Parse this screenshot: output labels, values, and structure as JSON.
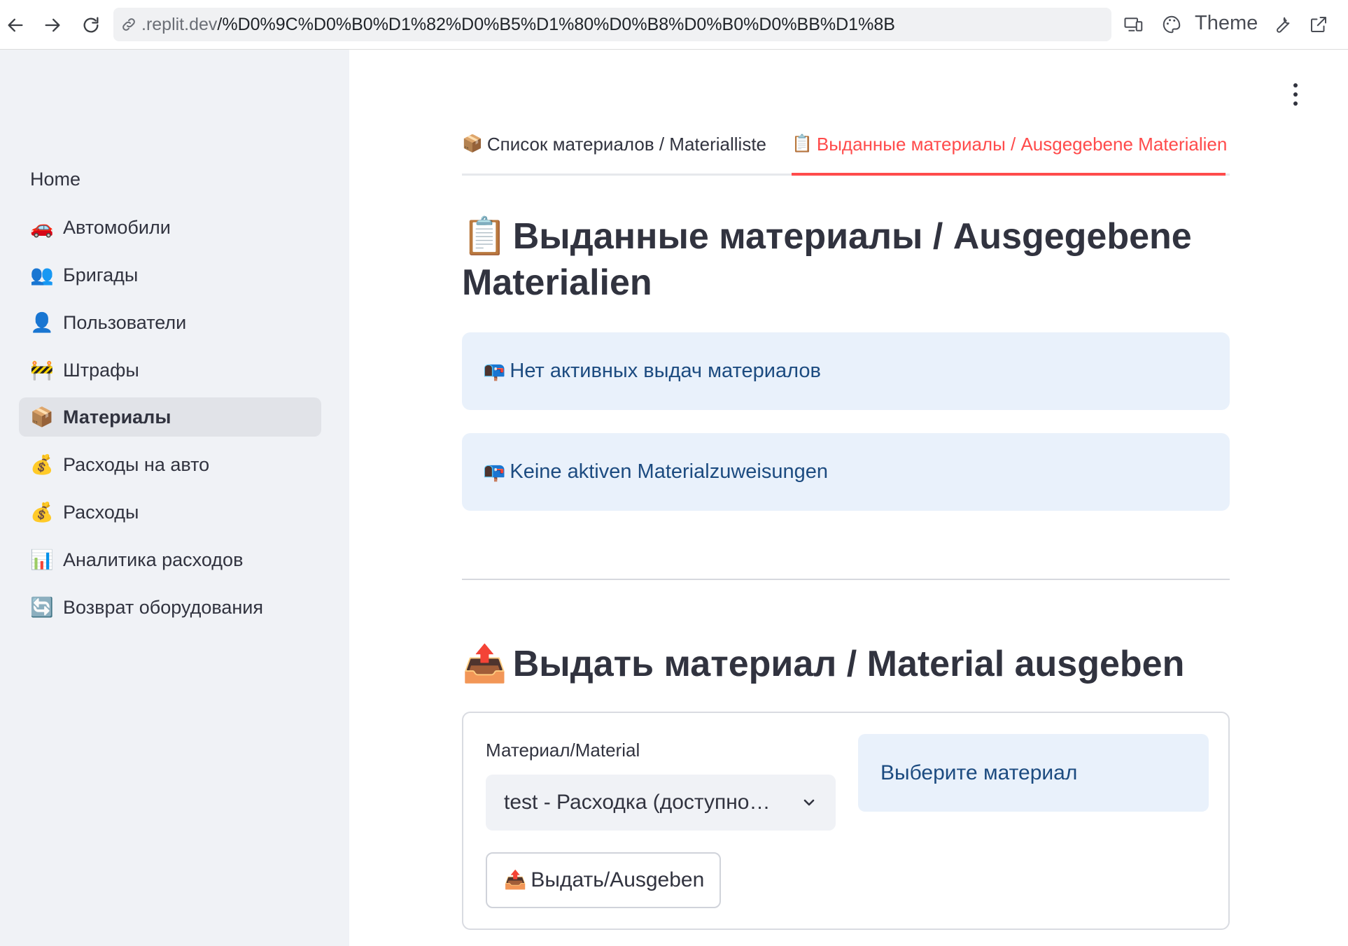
{
  "browser": {
    "url_host": ".replit.dev",
    "url_path": "/%D0%9C%D0%B0%D1%82%D0%B5%D1%80%D0%B8%D0%B0%D0%BB%D1%8B",
    "theme_label": "Theme",
    "icons": [
      "back-arrow-icon",
      "forward-arrow-icon",
      "reload-icon",
      "link-icon",
      "devices-icon",
      "palette-icon",
      "wrench-icon",
      "external-link-icon"
    ]
  },
  "sidebar": {
    "home_label": "Home",
    "items": [
      {
        "emoji": "🚗",
        "label": "Автомобили"
      },
      {
        "emoji": "👥",
        "label": "Бригады"
      },
      {
        "emoji": "👤",
        "label": "Пользователи"
      },
      {
        "emoji": "🚧",
        "label": "Штрафы"
      },
      {
        "emoji": "📦",
        "label": "Материалы",
        "active": true
      },
      {
        "emoji": "💰",
        "label": "Расходы на авто"
      },
      {
        "emoji": "💰",
        "label": "Расходы"
      },
      {
        "emoji": "📊",
        "label": "Аналитика расходов"
      },
      {
        "emoji": "🔄",
        "label": "Возврат оборудования"
      }
    ]
  },
  "tabs": [
    {
      "emoji": "📦",
      "label": "Список материалов / Materialliste"
    },
    {
      "emoji": "📋",
      "label": "Выданные материалы / Ausgegebene Materialien",
      "active": true
    }
  ],
  "issued": {
    "emoji": "📋",
    "title": "Выданные материалы / Ausgegebene Materialien",
    "info_ru": {
      "emoji": "📭",
      "text": "Нет активных выдач материалов"
    },
    "info_de": {
      "emoji": "📭",
      "text": "Keine aktiven Materialzuweisungen"
    }
  },
  "issue_form": {
    "emoji": "📤",
    "title": "Выдать материал / Material ausgeben",
    "material_label": "Материал/Material",
    "material_value": "test - Расходка (доступно…",
    "hint": "Выберите материал",
    "submit_emoji": "📤",
    "submit_label": "Выдать/Ausgeben"
  },
  "colors": {
    "accent": "#ff4b4b",
    "info_bg": "#e9f1fb",
    "info_text": "#1c4b80",
    "sidebar_bg": "#f0f2f6"
  }
}
